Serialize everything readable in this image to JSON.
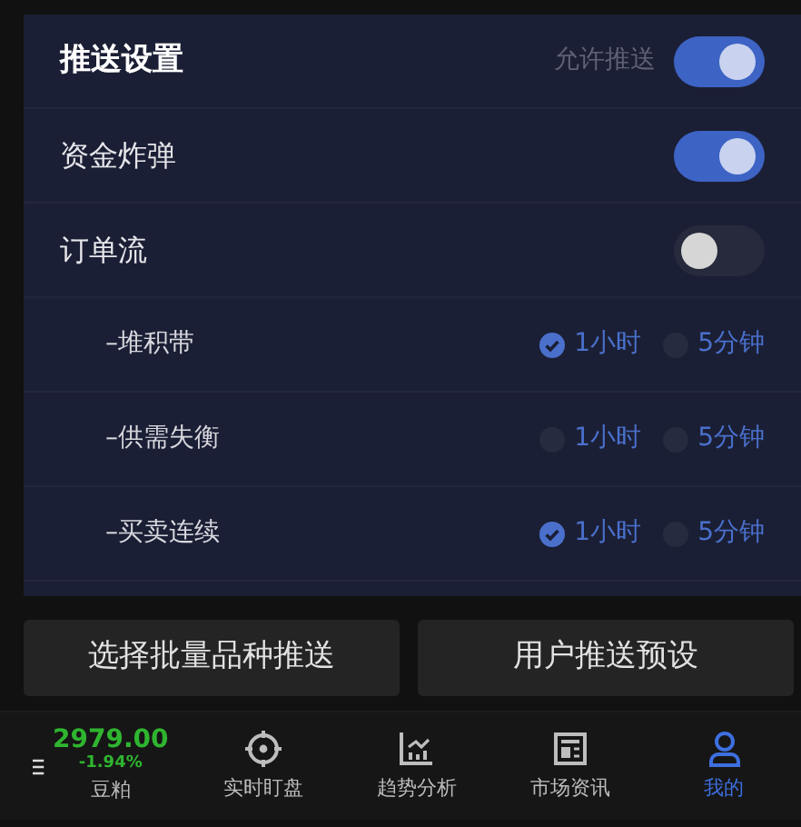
{
  "header": {
    "title": "推送设置",
    "label": "允许推送",
    "on": true
  },
  "toggles": [
    {
      "label": "资金炸弹",
      "on": true
    },
    {
      "label": "订单流",
      "on": false
    }
  ],
  "sub_rows": [
    {
      "label": "–堆积带",
      "options": [
        {
          "label": "1小时",
          "selected": true
        },
        {
          "label": "5分钟",
          "selected": false
        }
      ]
    },
    {
      "label": "–供需失衡",
      "options": [
        {
          "label": "1小时",
          "selected": false
        },
        {
          "label": "5分钟",
          "selected": false
        }
      ]
    },
    {
      "label": "–买卖连续",
      "options": [
        {
          "label": "1小时",
          "selected": true
        },
        {
          "label": "5分钟",
          "selected": false
        }
      ]
    }
  ],
  "buttons": [
    "选择批量品种推送",
    "用户推送预设"
  ],
  "tab_bar": {
    "quote": {
      "price": "2979.00",
      "change": "-1.94%",
      "name": "豆粕"
    },
    "tabs": [
      {
        "label": "实时盯盘",
        "selected": false
      },
      {
        "label": "趋势分析",
        "selected": false
      },
      {
        "label": "市场资讯",
        "selected": false
      },
      {
        "label": "我的",
        "selected": true
      }
    ]
  }
}
